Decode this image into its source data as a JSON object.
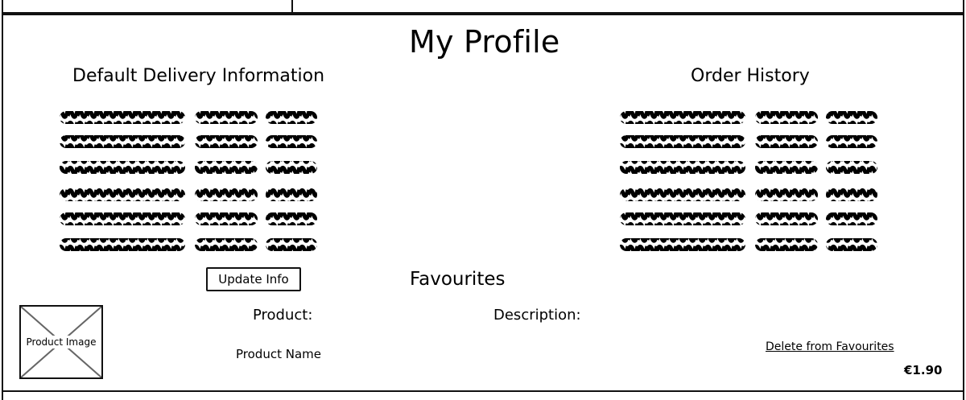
{
  "page": {
    "title": "My Profile"
  },
  "delivery": {
    "heading": "Default Delivery Information",
    "update_button": "Update Info"
  },
  "orders": {
    "heading": "Order History"
  },
  "favourites": {
    "heading": "Favourites",
    "product_label": "Product:",
    "description_label": "Description:",
    "product_image_placeholder": "Product Image",
    "product_name": "Product Name",
    "delete_link": "Delete from Favourites",
    "price": "€1.90"
  }
}
